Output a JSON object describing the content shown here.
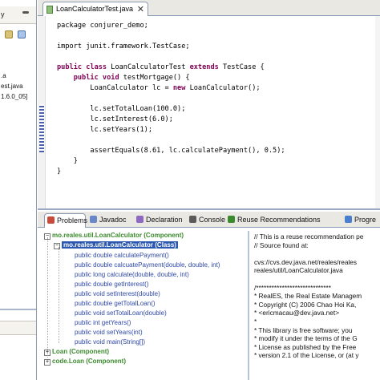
{
  "left_pane": {
    "tab_label": "y",
    "items": [
      ".a",
      "est.java",
      "1.6.0_05]"
    ]
  },
  "editor": {
    "tab_label": "LoanCalculatorTest.java",
    "close_label": "✕",
    "code_lines": [
      {
        "parts": [
          {
            "t": "package conjurer_demo;",
            "k": false
          }
        ]
      },
      {
        "parts": []
      },
      {
        "parts": [
          {
            "t": "import junit.framework.TestCase;",
            "k": false
          }
        ]
      },
      {
        "parts": []
      },
      {
        "parts": [
          {
            "t": "public class",
            "k": true
          },
          {
            "t": " LoanCalculatorTest ",
            "k": false
          },
          {
            "t": "extends",
            "k": true
          },
          {
            "t": " TestCase {",
            "k": false
          }
        ]
      },
      {
        "parts": [
          {
            "t": "    ",
            "k": false
          },
          {
            "t": "public void",
            "k": true
          },
          {
            "t": " testMortgage() {",
            "k": false
          }
        ]
      },
      {
        "parts": [
          {
            "t": "        LoanCalculator lc = ",
            "k": false
          },
          {
            "t": "new",
            "k": true
          },
          {
            "t": " LoanCalculator();",
            "k": false
          }
        ]
      },
      {
        "parts": []
      },
      {
        "parts": [
          {
            "t": "        lc.setTotalLoan(100.0);",
            "k": false
          }
        ]
      },
      {
        "parts": [
          {
            "t": "        lc.setInterest(6.0);",
            "k": false
          }
        ]
      },
      {
        "parts": [
          {
            "t": "        lc.setYears(1);",
            "k": false
          }
        ]
      },
      {
        "parts": []
      },
      {
        "parts": [
          {
            "t": "        assertEquals(8.61, lc.calculatePayment(), 0.5);",
            "k": false
          }
        ]
      },
      {
        "parts": [
          {
            "t": "    }",
            "k": false
          }
        ]
      },
      {
        "parts": [
          {
            "t": "}",
            "k": false
          }
        ]
      }
    ]
  },
  "views": {
    "tabs": [
      {
        "label": "Problems",
        "icon_color": "#c84a3a",
        "active": true
      },
      {
        "label": "Javadoc",
        "icon_color": "#6a88c8",
        "active": false
      },
      {
        "label": "Declaration",
        "icon_color": "#8d6ac0",
        "active": false
      },
      {
        "label": "Console",
        "icon_color": "#5a5a5a",
        "active": false
      },
      {
        "label": "Reuse Recommendations",
        "icon_color": "#3c8a2e",
        "active": false
      },
      {
        "label": "Progre",
        "icon_color": "#4a7fd0",
        "active": false
      }
    ],
    "tree": [
      {
        "text": "mo.reales.util.LoanCalculator (Component)",
        "style": "green",
        "toggle": "−"
      },
      {
        "text": "mo.reales.util.LoanCalculator (Class)",
        "style": "sel",
        "toggle": "−"
      },
      {
        "text": "public double calculatePayment()",
        "style": "blue"
      },
      {
        "text": "public double calcuatePayment(double, double, int)",
        "style": "blue"
      },
      {
        "text": "public long calculate(double, double, int)",
        "style": "blue"
      },
      {
        "text": "public double getInterest()",
        "style": "blue"
      },
      {
        "text": "public void setInterest(double)",
        "style": "blue"
      },
      {
        "text": "public double getTotalLoan()",
        "style": "blue"
      },
      {
        "text": "public void setTotalLoan(double)",
        "style": "blue"
      },
      {
        "text": "public int getYears()",
        "style": "blue"
      },
      {
        "text": "public void setYears(int)",
        "style": "blue"
      },
      {
        "text": "public void main(String[])",
        "style": "blue"
      },
      {
        "text": "Loan (Component)",
        "style": "green",
        "toggle": "+"
      },
      {
        "text": "code.Loan (Component)",
        "style": "green",
        "toggle": "+"
      }
    ],
    "doc_lines": [
      "// This is a reuse recommendation pe",
      "// Source found at:",
      "",
      "cvs://cvs.dev.java.net/reales/reales",
      "reales/util/LoanCalculator.java",
      "",
      "/*****************************",
      " * RealES, the Real Estate Managem",
      " * Copyright (C) 2006 Chao Hoi Ka,",
      " * <ericmacau@dev.java.net>",
      " *",
      " * This library is free software; you",
      " * modify it under the terms of the G",
      " * License as published by the Free",
      " * version 2.1 of the License, or (at y"
    ]
  }
}
